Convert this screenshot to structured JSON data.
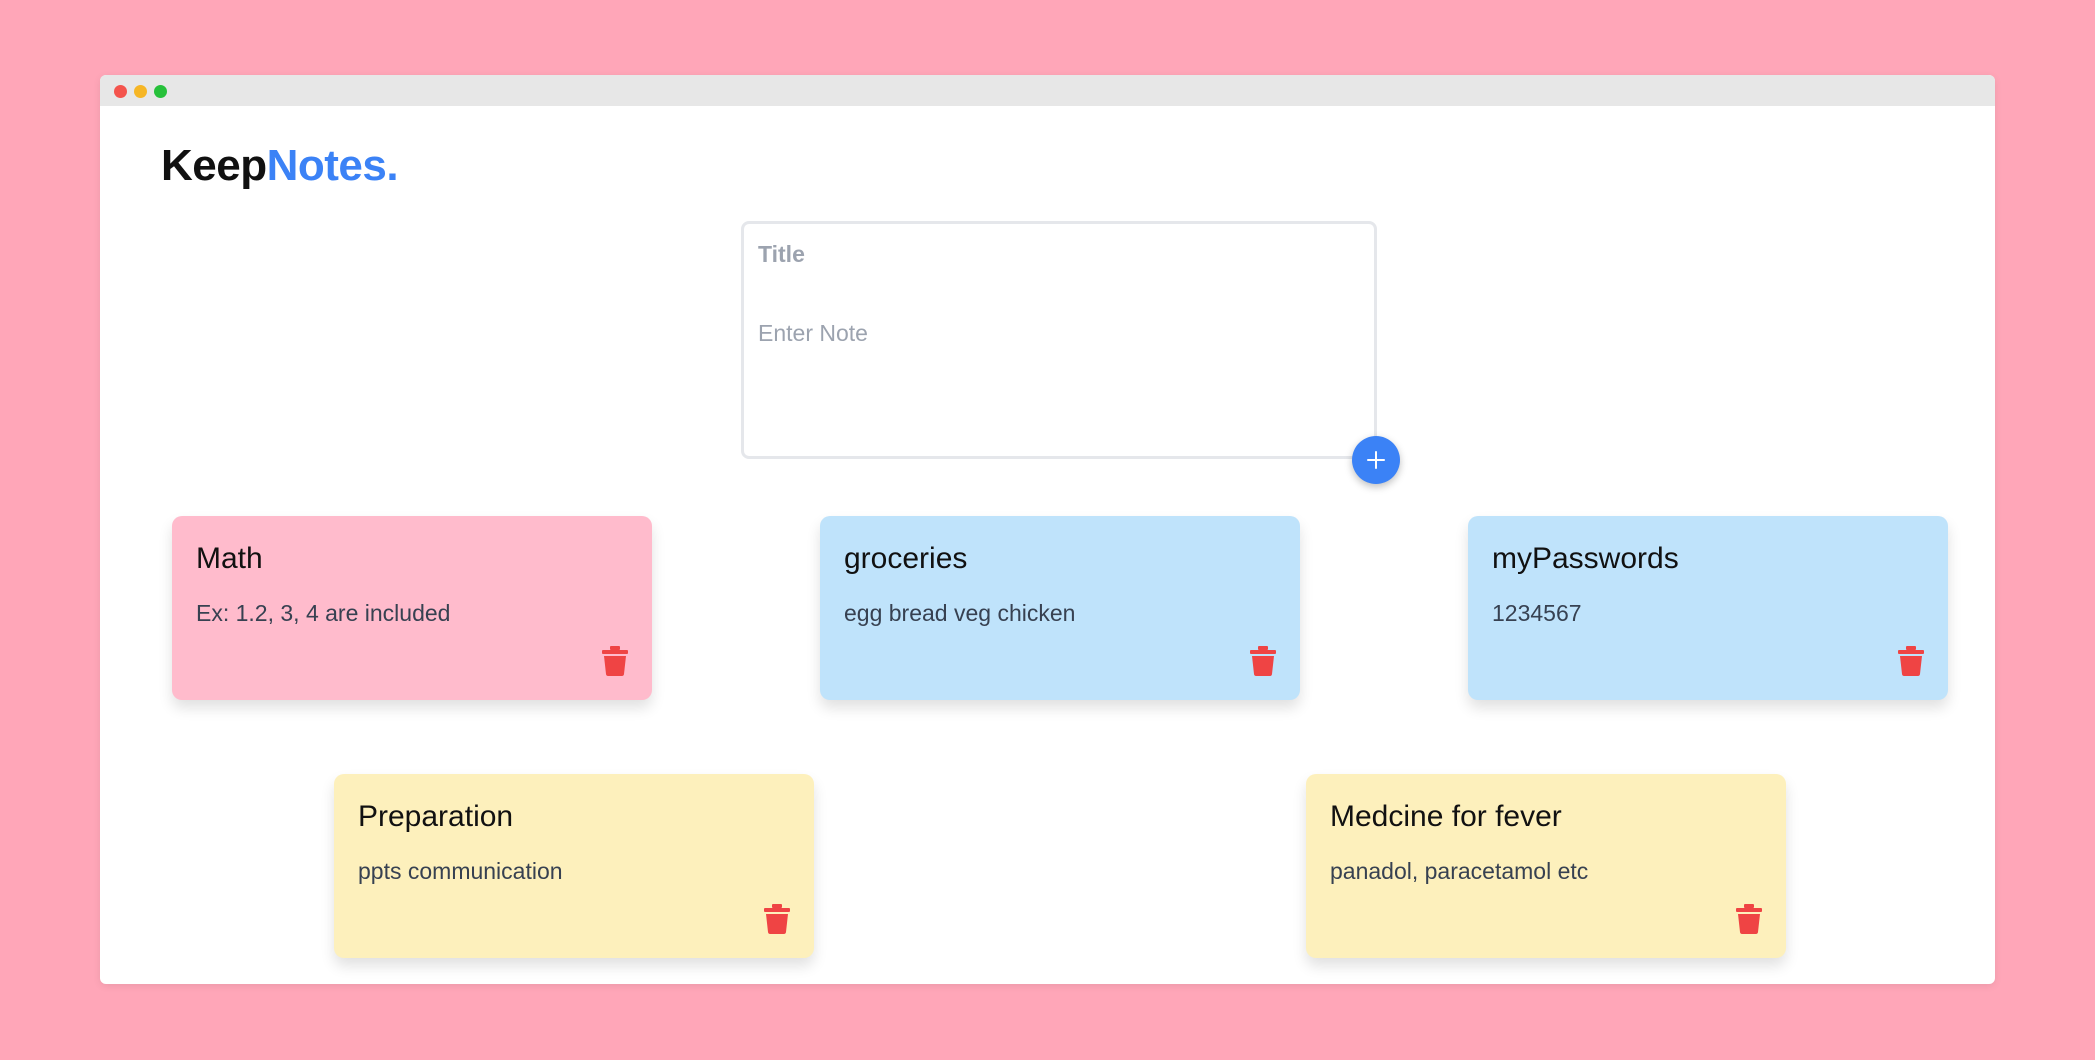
{
  "app": {
    "logo_part1": "Keep",
    "logo_part2": "Notes.",
    "accent_color": "#3b82f6",
    "delete_color": "#ef4444"
  },
  "composer": {
    "title_placeholder": "Title",
    "title_value": "",
    "note_placeholder": "Enter Note",
    "note_value": "",
    "add_icon": "plus-icon"
  },
  "notes": [
    {
      "title": "Math",
      "body": "Ex: 1.2, 3, 4 are included",
      "color": "#ffbbcc",
      "icon": "trash-icon"
    },
    {
      "title": "groceries",
      "body": "egg bread veg chicken",
      "color": "#bfe3fb",
      "icon": "trash-icon"
    },
    {
      "title": "myPasswords",
      "body": "1234567",
      "color": "#bfe3fb",
      "icon": "trash-icon"
    },
    {
      "title": "Preparation",
      "body": "ppts communication",
      "color": "#fdf0bc",
      "icon": "trash-icon"
    },
    {
      "title": "Medcine for fever",
      "body": "panadol, paracetamol etc",
      "color": "#fdf0bc",
      "icon": "trash-icon"
    }
  ]
}
